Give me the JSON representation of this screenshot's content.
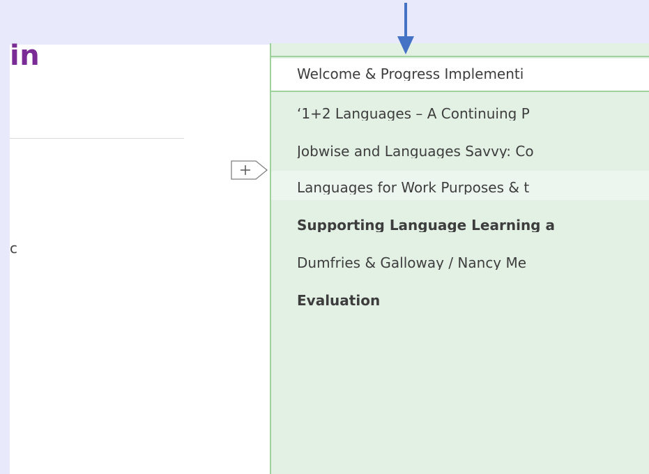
{
  "document": {
    "title_fragment": "in",
    "side_fragment": "c"
  },
  "notebook": {
    "section": "Welcome & Progress Implementi",
    "pages": [
      {
        "label": "‘1+2 Languages – A Continuing P",
        "bold": false,
        "selected": false
      },
      {
        "label": "Jobwise and Languages Savvy: Co",
        "bold": false,
        "selected": false
      },
      {
        "label": "Languages for Work Purposes & t",
        "bold": false,
        "selected": true
      },
      {
        "label": "Supporting Language Learning a",
        "bold": true,
        "selected": false
      },
      {
        "label": "Dumfries & Galloway / Nancy Me",
        "bold": false,
        "selected": false
      },
      {
        "label": "Evaluation",
        "bold": true,
        "selected": false
      }
    ]
  },
  "colors": {
    "background": "#e8e9fb",
    "title": "#7a2b95",
    "panel": "#e3f1e5",
    "panel_border": "#9fd19c",
    "arrow": "#4472c4"
  },
  "icons": {
    "add_page": "plus-tab-icon",
    "annotation": "down-arrow-icon"
  }
}
